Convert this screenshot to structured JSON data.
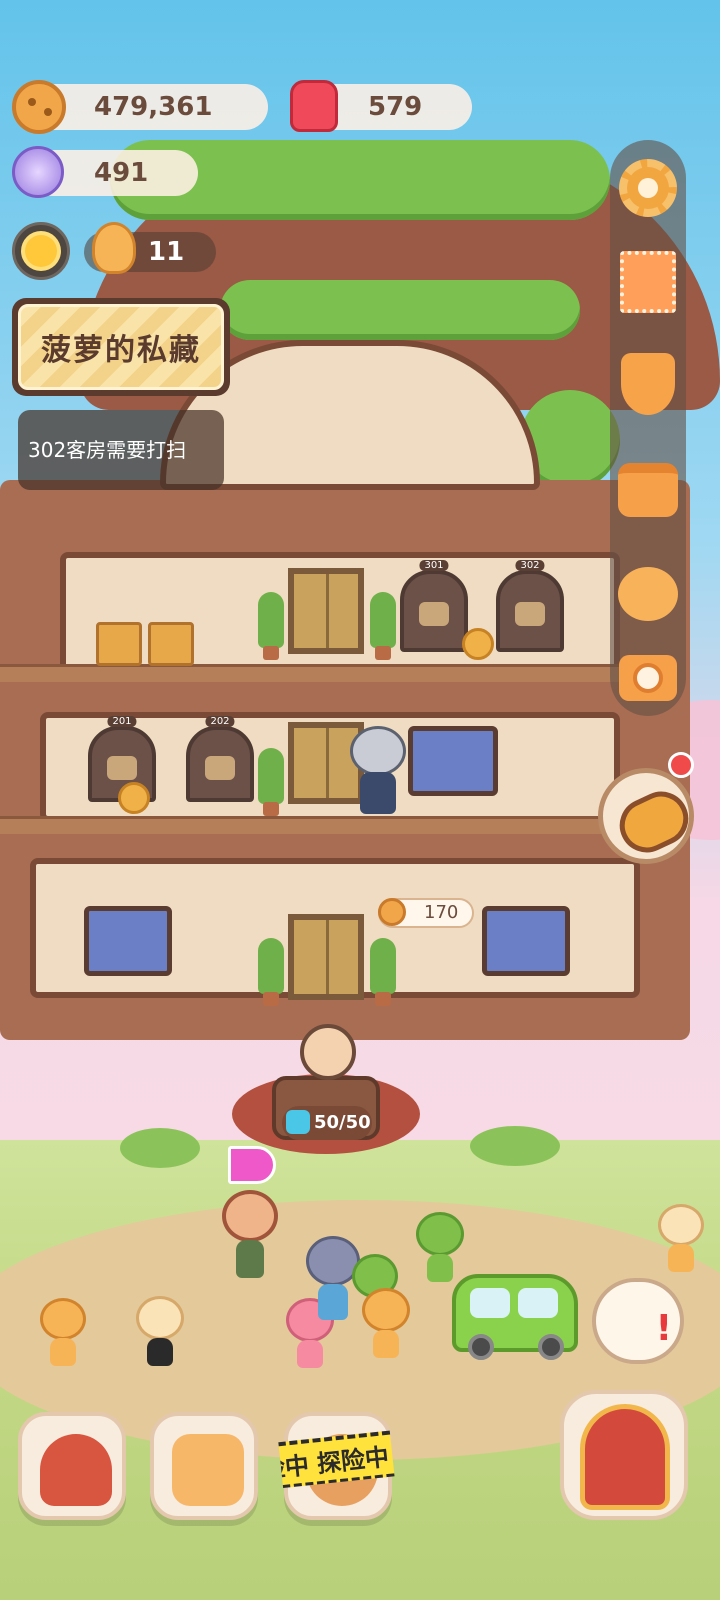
{
  "resources": {
    "cookies": "479,361",
    "jelly": "579",
    "crystals": "491",
    "staff_count": "11"
  },
  "banner": {
    "title": "菠萝的私藏"
  },
  "task": {
    "text": "302客房需要打扫"
  },
  "rooms": {
    "r301": "301",
    "r302": "302",
    "r201": "201",
    "r202": "202"
  },
  "price_tag": {
    "value": "170"
  },
  "energy": {
    "value": "50/50"
  },
  "expedition": {
    "label": "险中 探险中"
  },
  "side_menu": [
    "gear-icon",
    "stamp-icon",
    "medal-icon",
    "bag-icon",
    "friends-icon",
    "camera-icon"
  ],
  "colors": {
    "accent": "#f2a64a",
    "panel": "#5a3b2e",
    "alert": "#e8393c"
  }
}
